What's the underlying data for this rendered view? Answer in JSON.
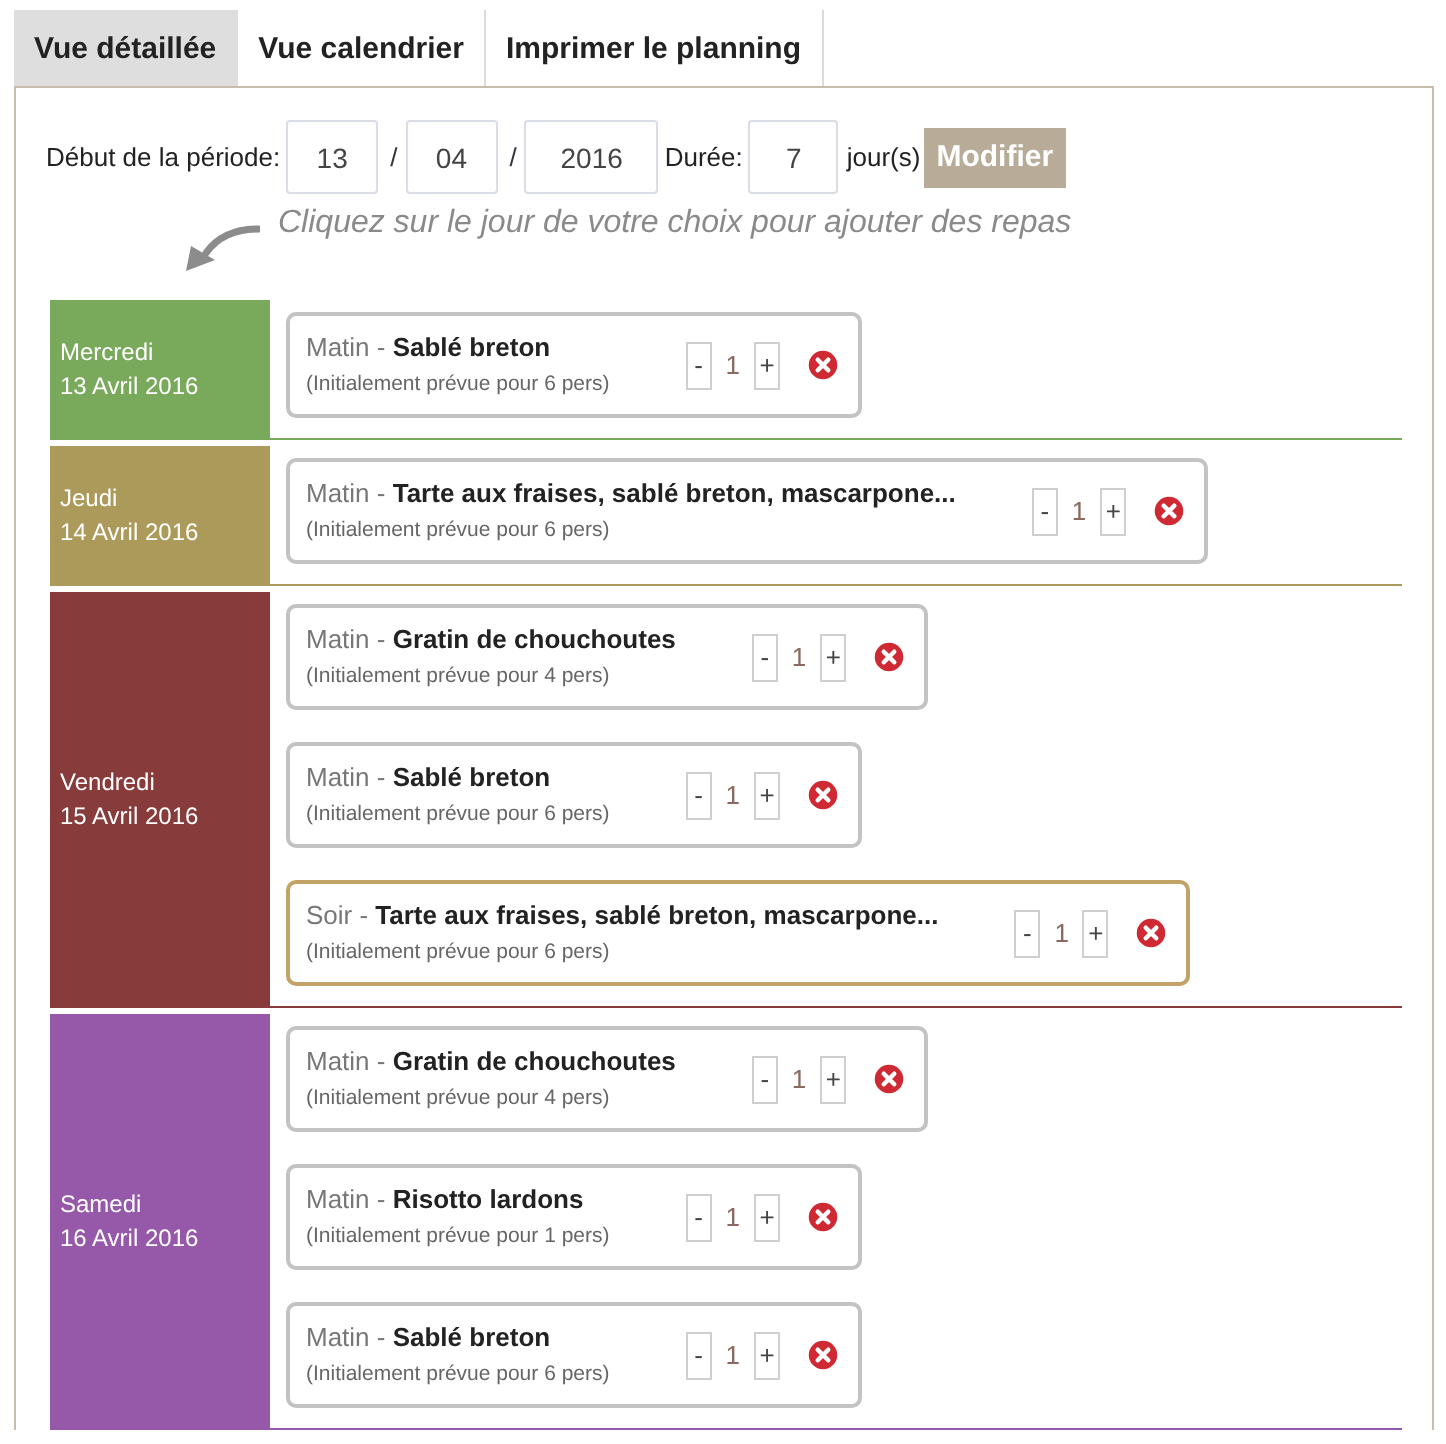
{
  "tabs": [
    {
      "label": "Vue détaillée",
      "selected": true
    },
    {
      "label": "Vue calendrier",
      "selected": false
    },
    {
      "label": "Imprimer le planning",
      "selected": false
    }
  ],
  "period": {
    "label": "Début de la période:",
    "day": "13",
    "separator_1": "/",
    "month": "04",
    "separator_2": "/",
    "year": "2016",
    "duration_label": "Durée:",
    "duration": "7",
    "unit": "jour(s)",
    "button": "Modifier"
  },
  "hint": "Cliquez sur le jour de votre choix pour ajouter des repas",
  "days": [
    {
      "weekday": "Mercredi",
      "date": "13 Avril 2016",
      "color": "#79a95a",
      "meals": [
        {
          "title": "Matin - **Sablé breton**",
          "note": "(Initialement prévue pour 6 pers)",
          "decrement": "-",
          "quantity": "1",
          "increment": "+",
          "highlighted": false
        }
      ]
    },
    {
      "weekday": "Jeudi",
      "date": "14 Avril 2016",
      "color": "#ab9a59",
      "meals": [
        {
          "title": "Matin - **Tarte aux fraises, sablé breton, mascarpone...**",
          "note": "(Initialement prévue pour 6 pers)",
          "decrement": "-",
          "quantity": "1",
          "increment": "+",
          "highlighted": false
        }
      ]
    },
    {
      "weekday": "Vendredi",
      "date": "15 Avril 2016",
      "color": "#883b3b",
      "meals": [
        {
          "title": "Matin - **Gratin de chouchoutes**",
          "note": "(Initialement prévue pour 4 pers)",
          "decrement": "-",
          "quantity": "1",
          "increment": "+",
          "highlighted": false
        },
        {
          "title": "Matin - **Sablé breton**",
          "note": "(Initialement prévue pour 6 pers)",
          "decrement": "-",
          "quantity": "1",
          "increment": "+",
          "highlighted": false
        },
        {
          "title": "Soir - **Tarte aux fraises, sablé breton, mascarpone...**",
          "note": "(Initialement prévue pour 6 pers)",
          "decrement": "-",
          "quantity": "1",
          "increment": "+",
          "highlighted": true
        }
      ]
    },
    {
      "weekday": "Samedi",
      "date": "16 Avril 2016",
      "color": "#9658a8",
      "meals": [
        {
          "title": "Matin - **Gratin de chouchoutes**",
          "note": "(Initialement prévue pour 4 pers)",
          "decrement": "-",
          "quantity": "1",
          "increment": "+",
          "highlighted": false
        },
        {
          "title": "Matin - **Risotto lardons**",
          "note": "(Initialement prévue pour 1 pers)",
          "decrement": "-",
          "quantity": "1",
          "increment": "+",
          "highlighted": false
        },
        {
          "title": "Matin - **Sablé breton**",
          "note": "(Initialement prévue pour 6 pers)",
          "decrement": "-",
          "quantity": "1",
          "increment": "+",
          "highlighted": false
        }
      ]
    }
  ]
}
